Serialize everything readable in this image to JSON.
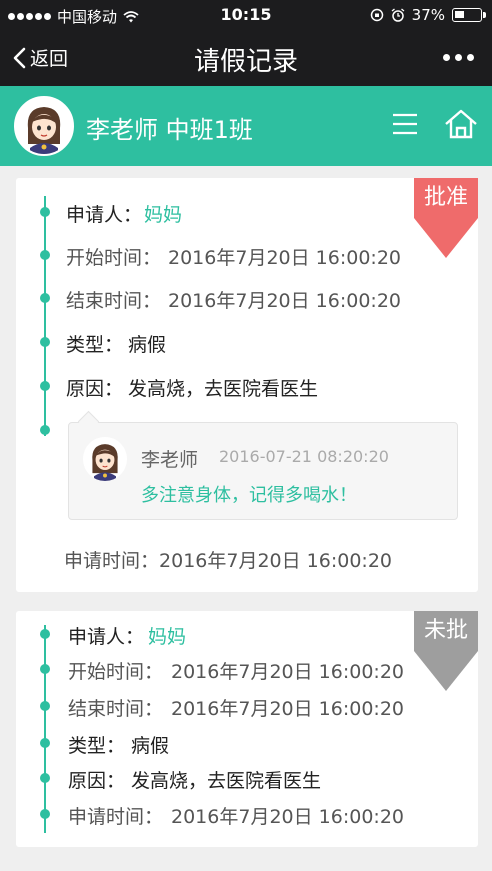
{
  "status_bar": {
    "carrier": "中国移动",
    "time": "10:15",
    "battery": "37%",
    "battery_level": 0.37
  },
  "nav": {
    "back_label": "返回",
    "title": "请假记录"
  },
  "profile": {
    "name": "李老师 中班1班"
  },
  "records": [
    {
      "status": "批准",
      "status_color": "#ef6b6b",
      "applicant_label": "申请人：",
      "applicant": "妈妈",
      "start_label": "开始时间：",
      "start": "2016年7月20日 16:00:20",
      "end_label": "结束时间：",
      "end": "2016年7月20日 16:00:20",
      "type_label": "类型：",
      "type": "病假",
      "reason_label": "原因：",
      "reason": "发高烧，去医院看医生",
      "reply": {
        "name": "李老师",
        "time": "2016-07-21 08:20:20",
        "text": "多注意身体，记得多喝水！"
      },
      "apply_label": "申请时间：",
      "apply_time": "2016年7月20日 16:00:20"
    },
    {
      "status": "未批",
      "status_color": "#9e9e9e",
      "applicant_label": "申请人：",
      "applicant": "妈妈",
      "start_label": "开始时间：",
      "start": "2016年7月20日 16:00:20",
      "end_label": "结束时间：",
      "end": "2016年7月20日 16:00:20",
      "type_label": "类型：",
      "type": "病假",
      "reason_label": "原因：",
      "reason": "发高烧，去医院看医生",
      "apply_label": "申请时间：",
      "apply_time": "2016年7月20日 16:00:20"
    }
  ],
  "colors": {
    "accent": "#2ebfa0",
    "header": "#1c1c1e"
  },
  "icons": {
    "back": "chevron-left-icon",
    "more": "more-dots-icon",
    "menu": "menu-icon",
    "home": "home-icon",
    "wifi": "wifi-icon",
    "alarm": "alarm-icon"
  }
}
